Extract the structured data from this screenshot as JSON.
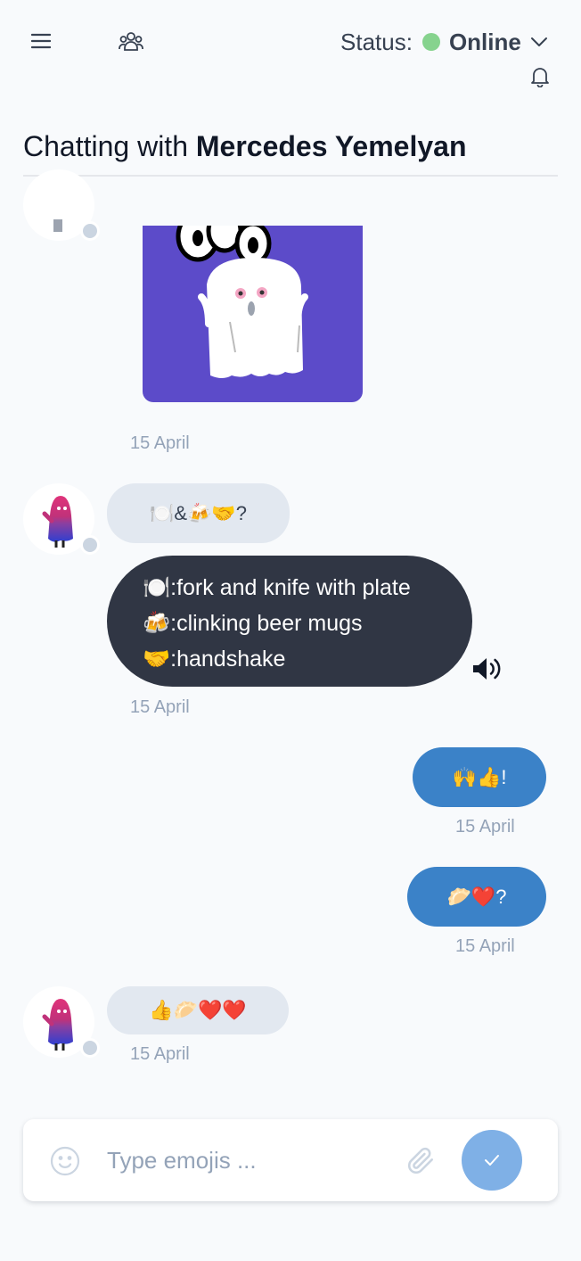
{
  "header": {
    "status_label": "Status:",
    "status_value": "Online",
    "status_color": "#86d38e"
  },
  "chat": {
    "title_prefix": "Chatting with ",
    "contact_name": "Mercedes Yemelyan"
  },
  "messages": [
    {
      "from": "contact",
      "kind": "sticker",
      "sticker": "boo-ghost-sticker",
      "time": "15 April"
    },
    {
      "from": "contact",
      "kind": "emoji",
      "text": "🍽️&🍻🤝?"
    },
    {
      "from": "contact",
      "kind": "translation",
      "lines": [
        "🍽️:fork and knife with plate",
        "🍻:clinking beer mugs",
        "🤝:handshake"
      ],
      "time": "15 April"
    },
    {
      "from": "me",
      "kind": "emoji",
      "text": "🙌👍!",
      "time": "15 April"
    },
    {
      "from": "me",
      "kind": "emoji",
      "text": "🥟❤️?",
      "time": "15 April"
    },
    {
      "from": "contact",
      "kind": "emoji",
      "text": "👍🥟❤️❤️",
      "time": "15 April"
    }
  ],
  "composer": {
    "placeholder": "Type emojis ..."
  },
  "colors": {
    "outgoing_bubble": "#3b82c8",
    "incoming_bubble": "#e2e8f0",
    "translation_bubble": "#303644",
    "send_button": "#7fb0e6",
    "presence_offline": "#cbd5e1"
  },
  "icons": [
    "menu-icon",
    "people-icon",
    "chevron-down-icon",
    "bell-icon",
    "speaker-icon",
    "smiley-icon",
    "paperclip-icon",
    "check-icon"
  ]
}
